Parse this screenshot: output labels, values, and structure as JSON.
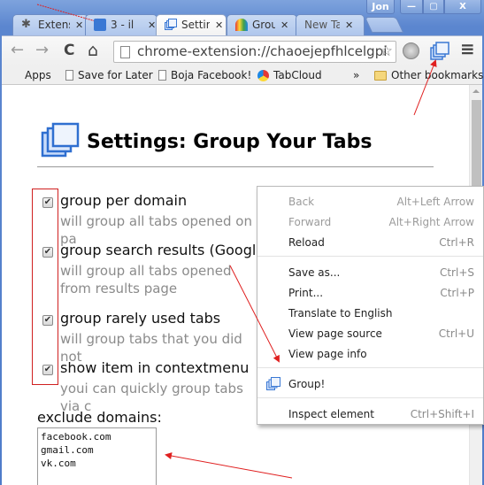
{
  "window": {
    "user_name": "Jon",
    "controls": {
      "minimize": "—",
      "maximize": "▢",
      "close": "X"
    }
  },
  "tabs": [
    {
      "label": "Extensions",
      "icon": "puzzle-icon",
      "close": "✕",
      "active": false
    },
    {
      "label": "3 - il",
      "icon": "site-favicon",
      "close": "✕",
      "active": false
    },
    {
      "label": "Settings",
      "icon": "group-tabs-icon",
      "close": "✕",
      "active": true
    },
    {
      "label": "Group",
      "icon": "rainbow-favicon",
      "close": "✕",
      "active": false
    },
    {
      "label": "New Tab",
      "icon": "",
      "close": "✕",
      "active": false
    }
  ],
  "toolbar": {
    "back": "←",
    "forward": "→",
    "reload": "C",
    "home": "⌂",
    "url": "chrome-extension://chaoejepfhlcelgpi",
    "star": "☆",
    "menu": "≡"
  },
  "bookmarks": {
    "apps": "Apps",
    "items": [
      "Save for Later",
      "Boja Facebook!",
      "TabCloud"
    ],
    "overflow": "»",
    "other": "Other bookmarks"
  },
  "page": {
    "title": "Settings: Group Your Tabs",
    "options": [
      {
        "label": "group per domain",
        "desc": "will group all tabs opened on pa",
        "checked": true
      },
      {
        "label": "group search results (Google",
        "desc": "will group all tabs opened from results page",
        "checked": true
      },
      {
        "label": "group rarely used tabs",
        "desc": "will group tabs that you did not",
        "checked": true
      },
      {
        "label": "show item in contextmenu",
        "desc": "youi can quickly group tabs via c",
        "checked": true
      }
    ],
    "exclude_label": "exclude domains:",
    "exclude_value": "facebook.com\ngmail.com\nvk.com"
  },
  "context_menu": {
    "items": [
      {
        "label": "Back",
        "shortcut": "Alt+Left Arrow",
        "disabled": true
      },
      {
        "label": "Forward",
        "shortcut": "Alt+Right Arrow",
        "disabled": true
      },
      {
        "label": "Reload",
        "shortcut": "Ctrl+R",
        "disabled": false
      },
      {
        "label": "Save as...",
        "shortcut": "Ctrl+S",
        "disabled": false
      },
      {
        "label": "Print...",
        "shortcut": "Ctrl+P",
        "disabled": false
      },
      {
        "label": "Translate to English",
        "shortcut": "",
        "disabled": false
      },
      {
        "label": "View page source",
        "shortcut": "Ctrl+U",
        "disabled": false
      },
      {
        "label": "View page info",
        "shortcut": "",
        "disabled": false
      },
      {
        "label": "Group!",
        "shortcut": "",
        "disabled": false
      },
      {
        "label": "Inspect element",
        "shortcut": "Ctrl+Shift+I",
        "disabled": false
      }
    ]
  },
  "colors": {
    "annotation": "#e02020",
    "frame": "#4f7cc9",
    "icon_blue": "#3a78d4"
  }
}
